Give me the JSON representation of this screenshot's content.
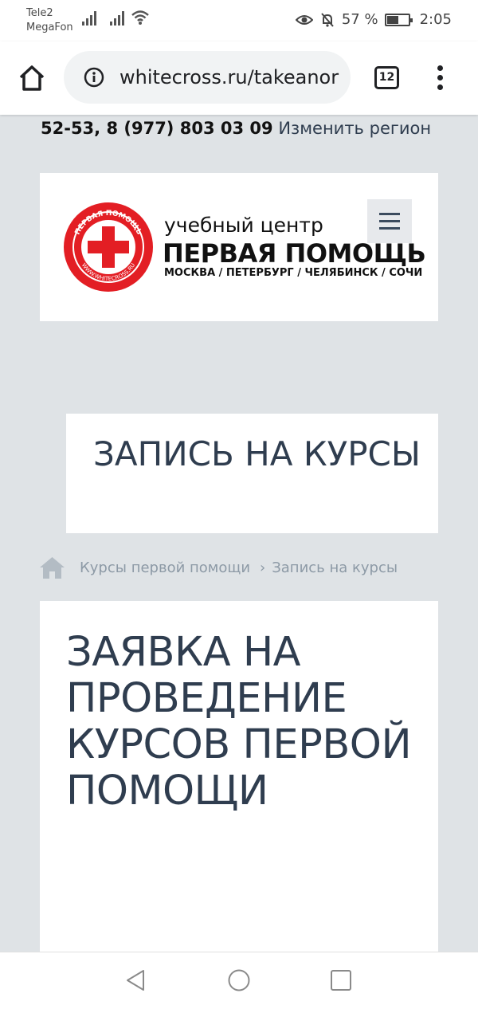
{
  "status_bar": {
    "carrier_1": "Tele2",
    "carrier_2": "MegaFon",
    "battery_percent": "57 %",
    "battery_level": 0.57,
    "time": "2:05"
  },
  "browser": {
    "url": "whitecross.ru/takeanor",
    "tab_count": "12"
  },
  "contact": {
    "phone": "52-53, 8 (977) 803 03 09",
    "change_region": "Изменить регион"
  },
  "logo": {
    "subtitle": "учебный центр",
    "name": "ПЕРВАЯ ПОМОЩЬ",
    "cities": "МОСКВА / ПЕТЕРБУРГ / ЧЕЛЯБИНСК / СОЧИ",
    "seal_text_top": "ПЕРВАЯ ПОМОЩЬ",
    "seal_text_bottom": "WWW.WHITECROSS.RU"
  },
  "page": {
    "title": "ЗАПИСЬ НА КУРСЫ",
    "breadcrumb": [
      "Курсы первой помощи",
      "Запись на курсы"
    ],
    "heading": "ЗАЯВКА НА ПРОВЕДЕНИЕ КУРСОВ ПЕРВОЙ ПОМОЩИ"
  },
  "colors": {
    "background": "#dfe3e6",
    "text_dark": "#2f3d4f",
    "brand_red": "#e31e24"
  },
  "icons": [
    "signal-icon",
    "wifi-icon",
    "eye-icon",
    "bell-off-icon",
    "battery-icon",
    "home-icon",
    "info-icon",
    "tabs-icon",
    "more-icon",
    "menu-icon",
    "breadcrumb-home-icon",
    "back-icon",
    "home-nav-icon",
    "recents-icon"
  ]
}
